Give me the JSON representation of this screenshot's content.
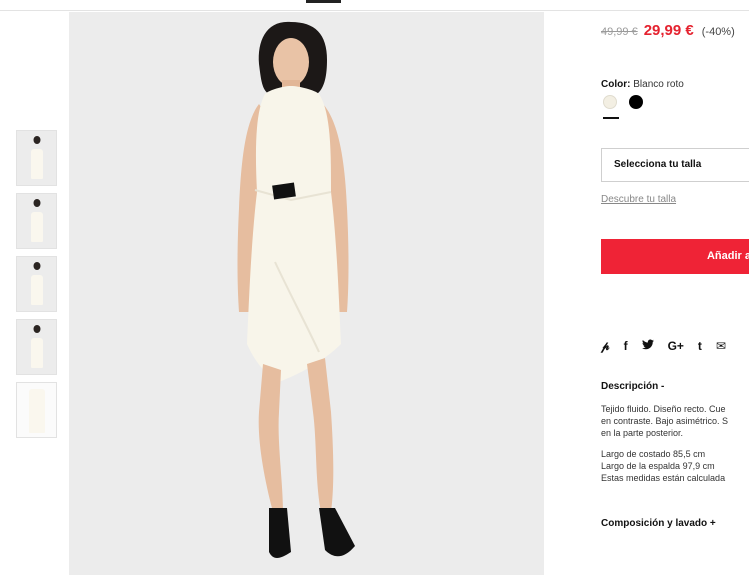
{
  "price": {
    "old": "49,99 €",
    "current": "29,99 €",
    "discount": "(-40%)"
  },
  "color": {
    "label": "Color:",
    "value": "Blanco roto",
    "swatches": [
      {
        "name": "white",
        "hex": "#f3efe3"
      },
      {
        "name": "black",
        "hex": "#000000"
      }
    ]
  },
  "size": {
    "select_label": "Selecciona tu talla",
    "guide_link": "Descubre tu talla"
  },
  "cart": {
    "add_label": "Añadir a"
  },
  "share": {
    "icons": [
      "pinterest-icon",
      "facebook-icon",
      "twitter-icon",
      "google-plus-icon",
      "tumblr-icon",
      "email-icon"
    ]
  },
  "description": {
    "title": "Descripción -",
    "lines": [
      "Tejido fluido. Diseño recto. Cue",
      "en contraste. Bajo asimétrico. S",
      "en la parte posterior."
    ],
    "measures": [
      "Largo de costado 85,5 cm",
      "Largo de la espalda 97,9 cm",
      "Estas medidas están calculada"
    ]
  },
  "composition": {
    "title": "Composición y lavado +"
  },
  "colors": {
    "accent": "#ef2336",
    "price_red": "#e5222f",
    "image_bg": "#ececec"
  }
}
